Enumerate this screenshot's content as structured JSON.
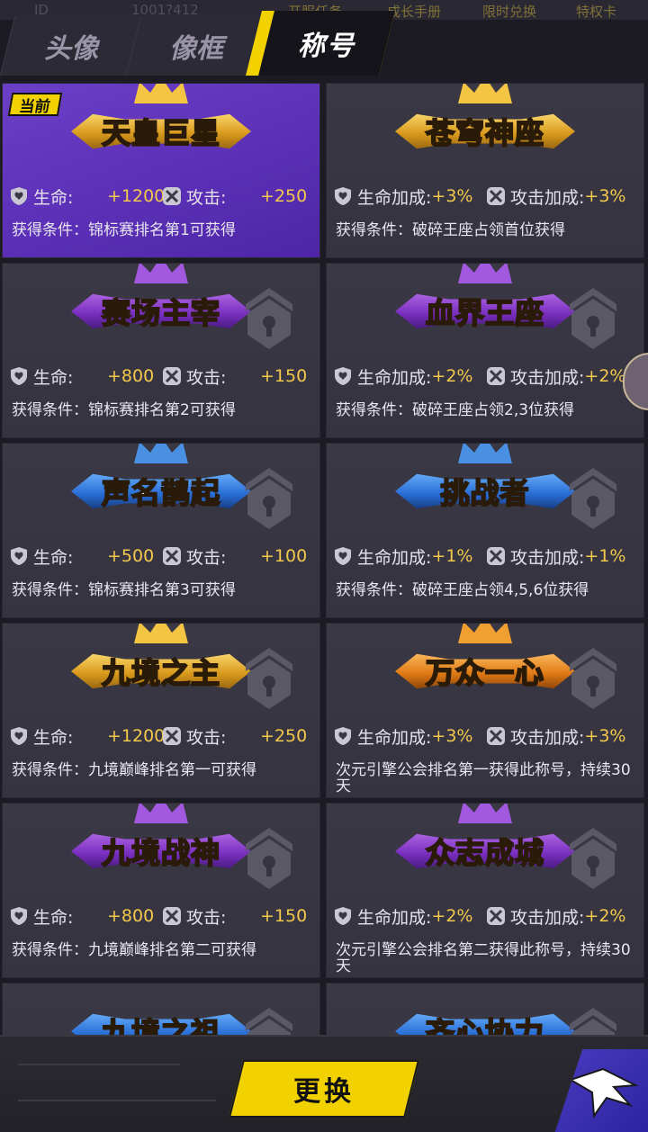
{
  "topstrip": {
    "ghost1": "ID",
    "ghost2": "1001?412",
    "y1": "开服任务",
    "y2": "成长手册",
    "y3": "限时兑换",
    "y4": "特权卡"
  },
  "tabs": [
    {
      "label": "头像"
    },
    {
      "label": "像框"
    },
    {
      "label": "称号"
    }
  ],
  "current_tag": "当前",
  "titles": [
    {
      "name": "天皇巨星",
      "stat1_label": "生命:",
      "stat1_value": "+1200",
      "stat2_label": "攻击:",
      "stat2_value": "+250",
      "condition": "获得条件：锦标赛排名第1可获得",
      "locked": false,
      "selected": true,
      "theme": "gold"
    },
    {
      "name": "苍穹神座",
      "stat1_label": "生命加成:",
      "stat1_value": "+3%",
      "stat2_label": "攻击加成:",
      "stat2_value": "+3%",
      "condition": "获得条件：破碎王座占领首位获得",
      "locked": false,
      "selected": false,
      "theme": "gold"
    },
    {
      "name": "赛场主宰",
      "stat1_label": "生命:",
      "stat1_value": "+800",
      "stat2_label": "攻击:",
      "stat2_value": "+150",
      "condition": "获得条件：锦标赛排名第2可获得",
      "locked": true,
      "selected": false,
      "theme": "purple"
    },
    {
      "name": "血界王座",
      "stat1_label": "生命加成:",
      "stat1_value": "+2%",
      "stat2_label": "攻击加成:",
      "stat2_value": "+2%",
      "condition": "获得条件：破碎王座占领2,3位获得",
      "locked": true,
      "selected": false,
      "theme": "purple"
    },
    {
      "name": "声名鹊起",
      "stat1_label": "生命:",
      "stat1_value": "+500",
      "stat2_label": "攻击:",
      "stat2_value": "+100",
      "condition": "获得条件：锦标赛排名第3可获得",
      "locked": true,
      "selected": false,
      "theme": "blue"
    },
    {
      "name": "挑战者",
      "stat1_label": "生命加成:",
      "stat1_value": "+1%",
      "stat2_label": "攻击加成:",
      "stat2_value": "+1%",
      "condition": "获得条件：破碎王座占领4,5,6位获得",
      "locked": true,
      "selected": false,
      "theme": "blue"
    },
    {
      "name": "九境之主",
      "stat1_label": "生命:",
      "stat1_value": "+1200",
      "stat2_label": "攻击:",
      "stat2_value": "+250",
      "condition": "获得条件：九境巅峰排名第一可获得",
      "locked": true,
      "selected": false,
      "theme": "gold"
    },
    {
      "name": "万众一心",
      "stat1_label": "生命加成:",
      "stat1_value": "+3%",
      "stat2_label": "攻击加成:",
      "stat2_value": "+3%",
      "condition": "次元引擎公会排名第一获得此称号，持续30天",
      "locked": true,
      "selected": false,
      "theme": "orange"
    },
    {
      "name": "九境战神",
      "stat1_label": "生命:",
      "stat1_value": "+800",
      "stat2_label": "攻击:",
      "stat2_value": "+150",
      "condition": "获得条件：九境巅峰排名第二可获得",
      "locked": true,
      "selected": false,
      "theme": "purple"
    },
    {
      "name": "众志成城",
      "stat1_label": "生命加成:",
      "stat1_value": "+2%",
      "stat2_label": "攻击加成:",
      "stat2_value": "+2%",
      "condition": "次元引擎公会排名第二获得此称号，持续30天",
      "locked": true,
      "selected": false,
      "theme": "purple"
    }
  ],
  "partial_titles": [
    {
      "name": "九境之祖",
      "theme": "blue"
    },
    {
      "name": "齐心协力",
      "theme": "blue"
    }
  ],
  "buttons": {
    "change": "更换"
  },
  "colors": {
    "accent": "#f2d100",
    "stat_value": "#f2c94c",
    "selected_card": "#5a2fb5",
    "card": "#3a3844"
  }
}
